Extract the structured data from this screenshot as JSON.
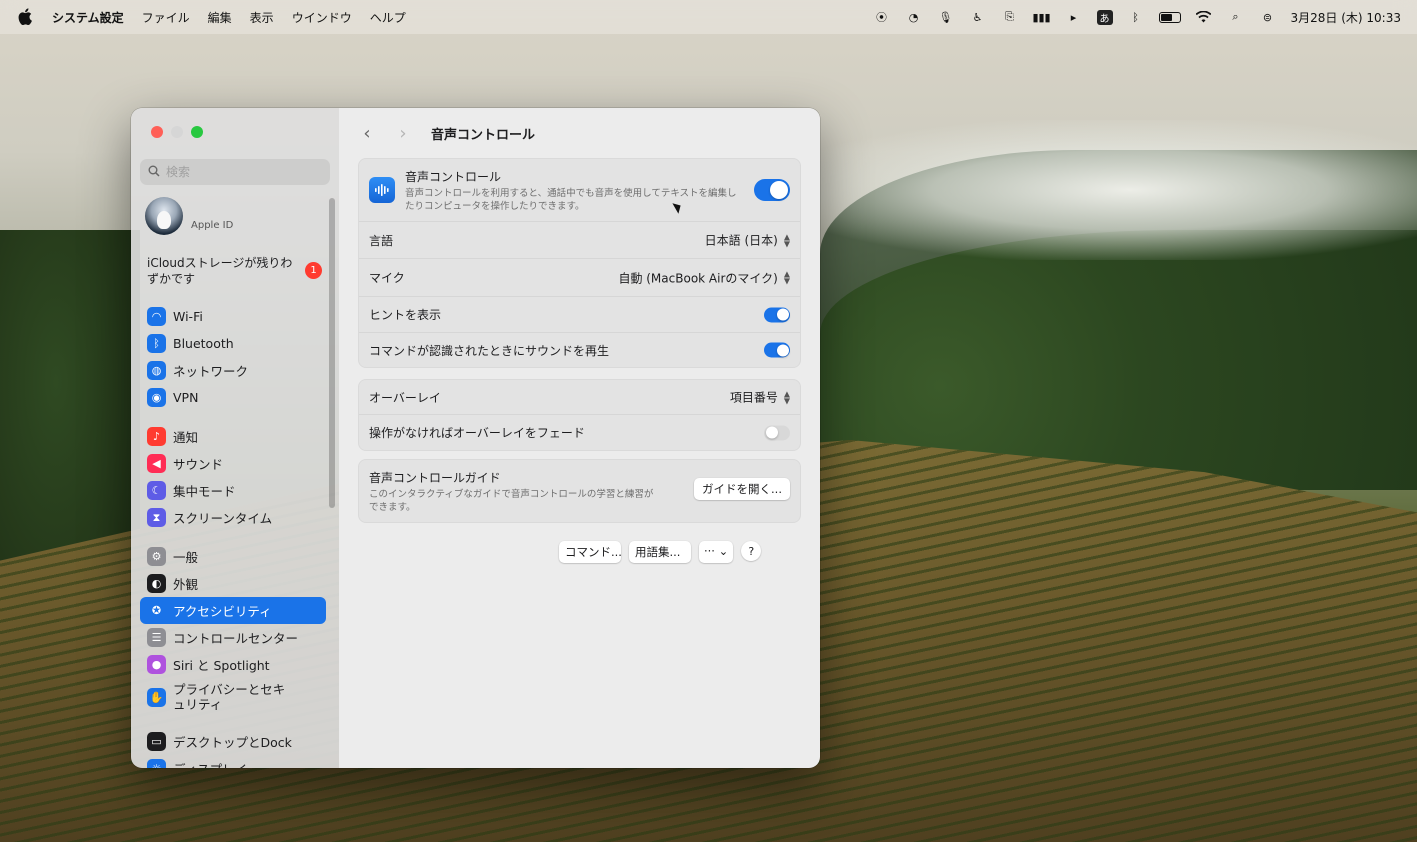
{
  "menubar": {
    "app_name": "システム設定",
    "menus": [
      "ファイル",
      "編集",
      "表示",
      "ウインドウ",
      "ヘルプ"
    ],
    "ime_label": "あ",
    "battery_level": 0.7,
    "datetime": "3月28日 (木)  10:33"
  },
  "sidebar": {
    "search_placeholder": "検索",
    "account_name": "Apple ID",
    "icloud_notice": "iCloudストレージが残りわずかです",
    "icloud_badge": "1",
    "items": [
      {
        "label": "Wi-Fi",
        "icon": "wifi-icon",
        "color": "#1a73e8"
      },
      {
        "label": "Bluetooth",
        "icon": "bluetooth-icon",
        "color": "#1a73e8"
      },
      {
        "label": "ネットワーク",
        "icon": "globe-icon",
        "color": "#1a73e8"
      },
      {
        "label": "VPN",
        "icon": "vpn-icon",
        "color": "#1a73e8"
      },
      {
        "label": "通知",
        "icon": "bell-icon",
        "color": "#ff3b30"
      },
      {
        "label": "サウンド",
        "icon": "speaker-icon",
        "color": "#ff2d55"
      },
      {
        "label": "集中モード",
        "icon": "moon-icon",
        "color": "#5e5ce6"
      },
      {
        "label": "スクリーンタイム",
        "icon": "hourglass-icon",
        "color": "#5e5ce6"
      },
      {
        "label": "一般",
        "icon": "gear-icon",
        "color": "#8e8e93"
      },
      {
        "label": "外観",
        "icon": "appearance-icon",
        "color": "#1c1c1e"
      },
      {
        "label": "アクセシビリティ",
        "icon": "accessibility-icon",
        "color": "#1a73e8"
      },
      {
        "label": "コントロールセンター",
        "icon": "control-center-icon",
        "color": "#8e8e93"
      },
      {
        "label": "Siri と Spotlight",
        "icon": "siri-icon",
        "color": "#af52de"
      },
      {
        "label": "プライバシーとセキュリティ",
        "icon": "hand-icon",
        "color": "#1a73e8"
      },
      {
        "label": "デスクトップとDock",
        "icon": "dock-icon",
        "color": "#1c1c1e"
      },
      {
        "label": "ディスプレイ",
        "icon": "display-icon",
        "color": "#1a73e8"
      }
    ],
    "active_index": 10
  },
  "content": {
    "title": "音声コントロール",
    "hero": {
      "title": "音声コントロール",
      "description": "音声コントロールを利用すると、通話中でも音声を使用してテキストを編集したりコンピュータを操作したりできます。",
      "enabled": true
    },
    "language_label": "言語",
    "language_value": "日本語 (日本)",
    "mic_label": "マイク",
    "mic_value": "自動 (MacBook Airのマイク)",
    "hints_label": "ヒントを表示",
    "hints_enabled": true,
    "sound_label": "コマンドが認識されたときにサウンドを再生",
    "sound_enabled": true,
    "overlay_label": "オーバーレイ",
    "overlay_value": "項目番号",
    "fade_label": "操作がなければオーバーレイをフェード",
    "fade_enabled": false,
    "guide_title": "音声コントロールガイド",
    "guide_desc": "このインタラクティブなガイドで音声コントロールの学習と練習ができます。",
    "guide_button": "ガイドを開く...",
    "commands_button": "コマンド...",
    "vocabulary_button": "用語集...",
    "more_button": "··· ⌄",
    "help_button": "?"
  }
}
